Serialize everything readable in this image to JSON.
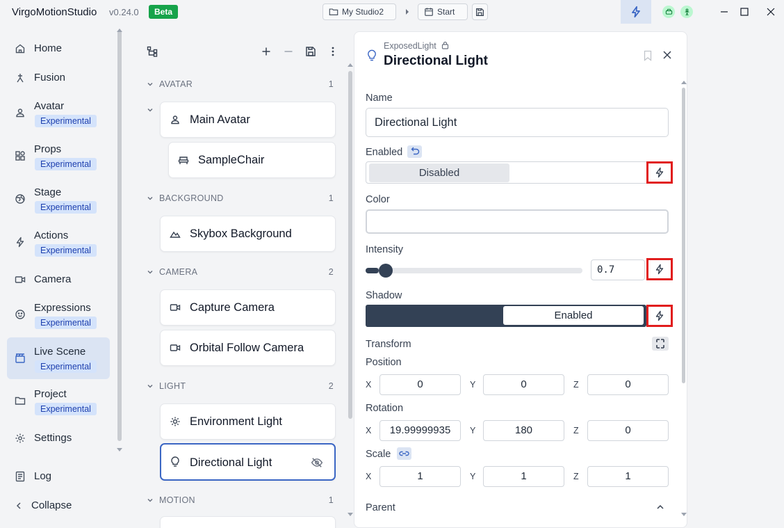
{
  "app": {
    "title": "VirgoMotionStudio",
    "version": "v0.24.0",
    "badge": "Beta"
  },
  "toolbar": {
    "project_label": "My Studio2",
    "start_label": "Start"
  },
  "sidebar": {
    "items": [
      {
        "label": "Home",
        "icon": "home-icon"
      },
      {
        "label": "Fusion",
        "icon": "fusion-icon"
      },
      {
        "label": "Avatar",
        "icon": "avatar-icon",
        "badge": "Experimental"
      },
      {
        "label": "Props",
        "icon": "props-icon",
        "badge": "Experimental"
      },
      {
        "label": "Stage",
        "icon": "globe-icon",
        "badge": "Experimental"
      },
      {
        "label": "Actions",
        "icon": "bolt-icon",
        "badge": "Experimental"
      },
      {
        "label": "Camera",
        "icon": "camera-icon"
      },
      {
        "label": "Expressions",
        "icon": "smile-icon",
        "badge": "Experimental"
      },
      {
        "label": "Live Scene",
        "icon": "clapper-icon",
        "badge": "Experimental",
        "active": true
      },
      {
        "label": "Project",
        "icon": "folder-icon",
        "badge": "Experimental"
      },
      {
        "label": "Settings",
        "icon": "gear-icon"
      }
    ],
    "log_label": "Log",
    "collapse_label": "Collapse"
  },
  "tree": {
    "sections": [
      {
        "label": "AVATAR",
        "count": "1",
        "items": [
          "Main Avatar",
          "SampleChair"
        ]
      },
      {
        "label": "BACKGROUND",
        "count": "1",
        "items": [
          "Skybox Background"
        ]
      },
      {
        "label": "CAMERA",
        "count": "2",
        "items": [
          "Capture Camera",
          "Orbital Follow Camera"
        ]
      },
      {
        "label": "LIGHT",
        "count": "2",
        "items": [
          "Environment Light",
          "Directional Light"
        ]
      },
      {
        "label": "MOTION",
        "count": "1",
        "items": []
      }
    ],
    "selected": "Directional Light"
  },
  "panel": {
    "type_label": "ExposedLight",
    "title": "Directional Light",
    "name_label": "Name",
    "name_value": "Directional Light",
    "enabled_label": "Enabled",
    "enabled_state": "Disabled",
    "color_label": "Color",
    "intensity_label": "Intensity",
    "intensity_value": "0.7",
    "intensity_fraction": 0.06,
    "shadow_label": "Shadow",
    "shadow_state": "Enabled",
    "transform_label": "Transform",
    "position_label": "Position",
    "position": {
      "x": "0",
      "y": "0",
      "z": "0"
    },
    "rotation_label": "Rotation",
    "rotation": {
      "x": "19.99999935",
      "y": "180",
      "z": "0"
    },
    "scale_label": "Scale",
    "scale": {
      "x": "1",
      "y": "1",
      "z": "1"
    },
    "parent_label": "Parent",
    "axis_labels": {
      "x": "X",
      "y": "Y",
      "z": "Z"
    }
  },
  "colors": {
    "accent": "#3b66c4",
    "badge_green": "#16a34a",
    "highlight_red": "#e11d1d",
    "shadow_dark": "#334155"
  }
}
